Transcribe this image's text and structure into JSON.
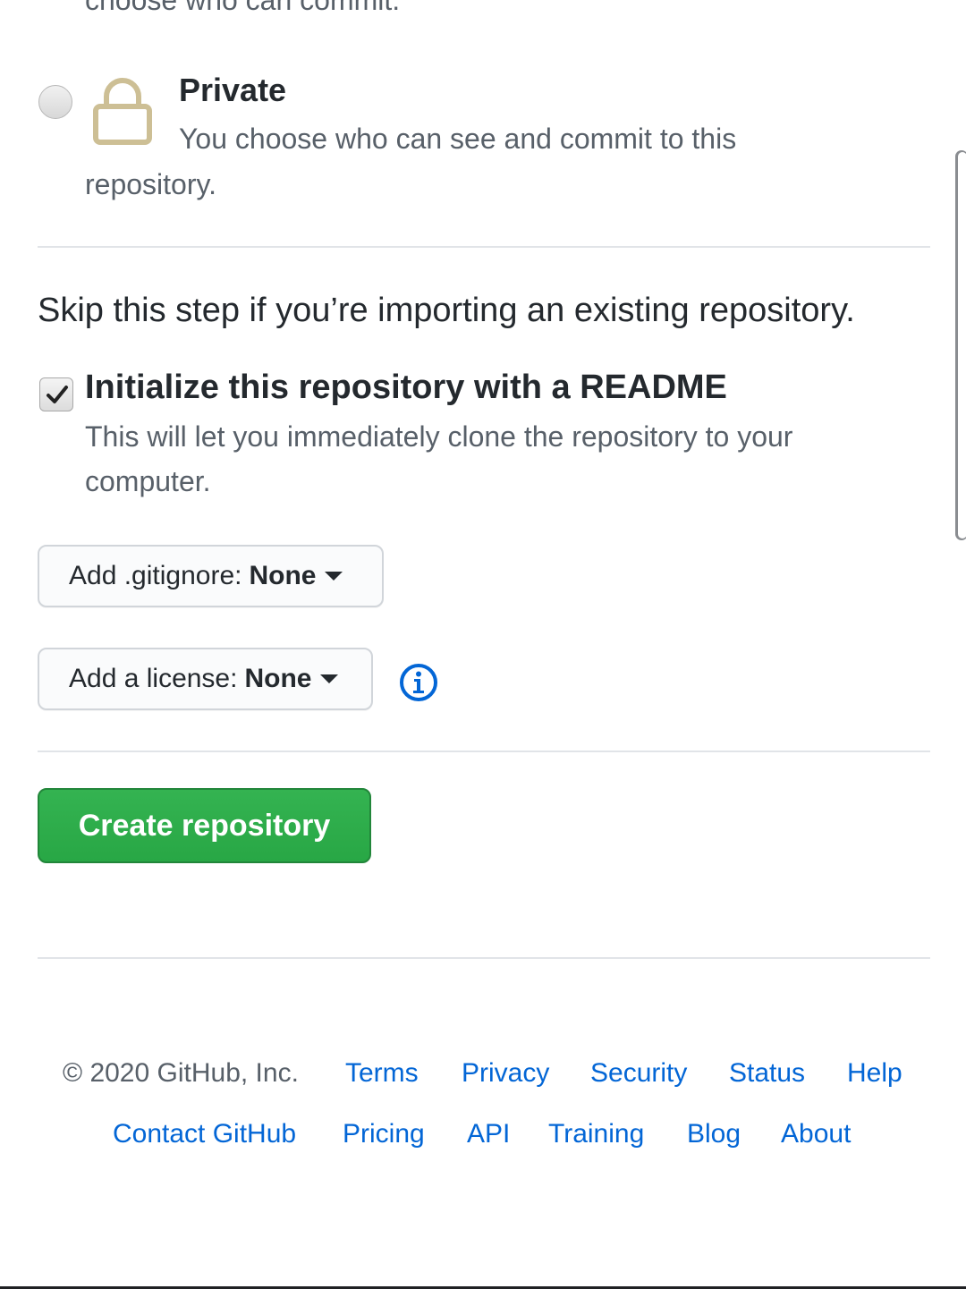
{
  "visibility": {
    "public_desc_cut": "choose who can commit.",
    "private_title": "Private",
    "private_desc_line1": "You choose who can see and commit to this",
    "private_desc_line2": "repository."
  },
  "init": {
    "skip_text": "Skip this step if you’re importing an existing repository.",
    "readme_label": "Initialize this repository with a README",
    "readme_checked": true,
    "readme_desc_line1": "This will let you immediately clone the repository to your",
    "readme_desc_line2": "computer."
  },
  "gitignore": {
    "label": "Add .gitignore:",
    "value": "None"
  },
  "license": {
    "label": "Add a license:",
    "value": "None",
    "info_icon": "info-icon"
  },
  "create": {
    "label": "Create repository",
    "color": "#28a745"
  },
  "footer": {
    "copyright": "© 2020 GitHub, Inc.",
    "links_row1": [
      "Terms",
      "Privacy",
      "Security",
      "Status",
      "Help"
    ],
    "links_row2": [
      "Contact GitHub",
      "Pricing",
      "API",
      "Training",
      "Blog",
      "About"
    ],
    "link_color": "#0366d6"
  }
}
